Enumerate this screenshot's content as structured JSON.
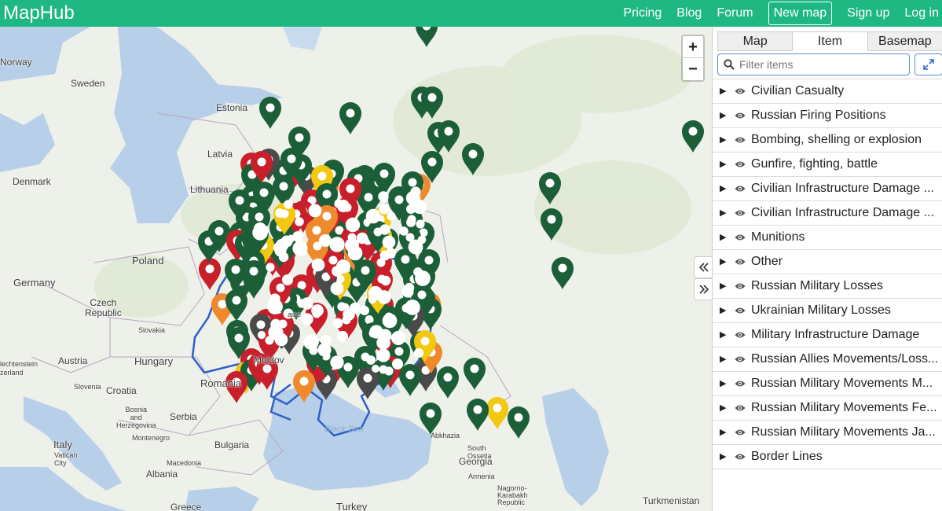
{
  "header": {
    "brand": "MapHub",
    "nav": [
      "Pricing",
      "Blog",
      "Forum",
      "New map",
      "Sign up",
      "Log in"
    ]
  },
  "map": {
    "labels": {
      "norway": "Norway",
      "sweden": "Sweden",
      "estonia": "Estonia",
      "latvia": "Latvia",
      "denmark": "Denmark",
      "lithuania": "Lithuania",
      "poland": "Poland",
      "germany": "Germany",
      "czech": "Czech\nRepublic",
      "slovakia": "Slovakia",
      "austria": "Austria",
      "hungary": "Hungary",
      "liechtenstein": "lechtenstein\nzerland",
      "slovenia": "Slovenia",
      "croatia": "Croatia",
      "bosnia": "Bosnia\nand\nHerzegovina",
      "serbia": "Serbia",
      "montenegro": "Montenegro",
      "romania": "Romania",
      "moldova": "Moldov",
      "bulgaria": "Bulgaria",
      "macedonia": "Macedonia",
      "albania": "Albania",
      "italy": "Italy",
      "vatican": "Vatican\nCity",
      "greece": "Greece",
      "turkey": "Turkey",
      "black_sea": "Black Sea",
      "abkhazia": "Abkhazia",
      "south_ossetia": "South\nOssetia",
      "georgia": "Georgia",
      "armenia": "Armenia",
      "nagorno": "Nagorno-\nKarabakh\nRepublic",
      "turkmenistan": "Turkmenistan",
      "ukraine": "aine"
    },
    "zoom_in": "+",
    "zoom_out": "−",
    "colors": {
      "green": "#1b5e38",
      "red": "#c8202a",
      "orange": "#ef8a2c",
      "yellow": "#f2c811",
      "gray": "#4a4a4a",
      "border": "#2f5fc7",
      "water": "#b7cfe8",
      "land": "#eef0ea"
    }
  },
  "sidebar": {
    "tabs": [
      "Map",
      "Item",
      "Basemap"
    ],
    "active_tab": "Item",
    "filter_placeholder": "Filter items",
    "items": [
      "Civilian Casualty",
      "Russian Firing Positions",
      "Bombing, shelling or explosion",
      "Gunfire, fighting, battle",
      "Civilian Infrastructure Damage ...",
      "Civilian Infrastructure Damage ...",
      "Munitions",
      "Other",
      "Russian Military Losses",
      "Ukrainian Military Losses",
      "Military Infrastructure Damage",
      "Russian Allies Movements/Loss...",
      "Russian Military Movements M...",
      "Russian Military Movements Fe...",
      "Russian Military Movements Ja...",
      "Border Lines"
    ]
  }
}
